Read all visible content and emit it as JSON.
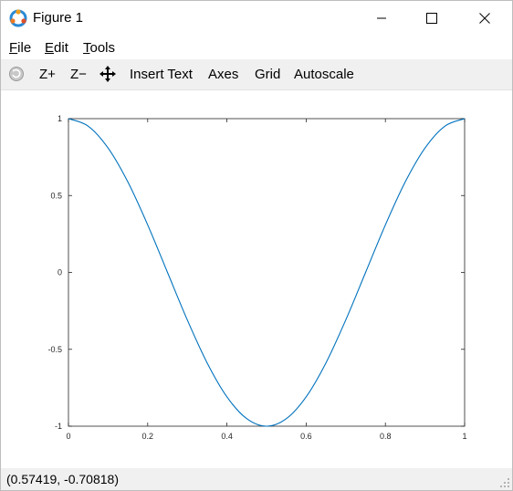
{
  "window": {
    "title": "Figure 1",
    "controls": {
      "minimize": "minimize",
      "maximize": "maximize",
      "close": "close"
    }
  },
  "menu": {
    "file": {
      "mnemonic": "F",
      "rest": "ile"
    },
    "edit": {
      "mnemonic": "E",
      "rest": "dit"
    },
    "tools": {
      "mnemonic": "T",
      "rest": "ools"
    }
  },
  "toolbar": {
    "rotate_icon": "rotate-icon",
    "zoom_in": "Z+",
    "zoom_out": "Z−",
    "pan_icon": "pan-icon",
    "insert_text": "Insert Text",
    "axes": "Axes",
    "grid": "Grid",
    "autoscale": "Autoscale"
  },
  "status": {
    "coordinates": "(0.57419, -0.70818)"
  },
  "chart_data": {
    "type": "line",
    "title": "",
    "xlabel": "",
    "ylabel": "",
    "xlim": [
      0,
      1
    ],
    "ylim": [
      -1,
      1
    ],
    "grid": false,
    "legend": "none",
    "x_ticks": [
      "0",
      "0.2",
      "0.4",
      "0.6",
      "0.8",
      "1"
    ],
    "y_ticks": [
      "1",
      "0.5",
      "0",
      "-0.5",
      "-1"
    ],
    "series": [
      {
        "color": "#0072bd",
        "x": [
          0,
          0.05,
          0.1,
          0.15,
          0.2,
          0.25,
          0.3,
          0.35,
          0.4,
          0.45,
          0.5,
          0.55,
          0.6,
          0.65,
          0.7,
          0.75,
          0.8,
          0.85,
          0.9,
          0.95,
          1
        ],
        "y": [
          1,
          0.951,
          0.809,
          0.588,
          0.309,
          0,
          -0.309,
          -0.588,
          -0.809,
          -0.951,
          -1,
          -0.951,
          -0.809,
          -0.588,
          -0.309,
          0,
          0.309,
          0.588,
          0.809,
          0.951,
          1
        ]
      }
    ]
  }
}
